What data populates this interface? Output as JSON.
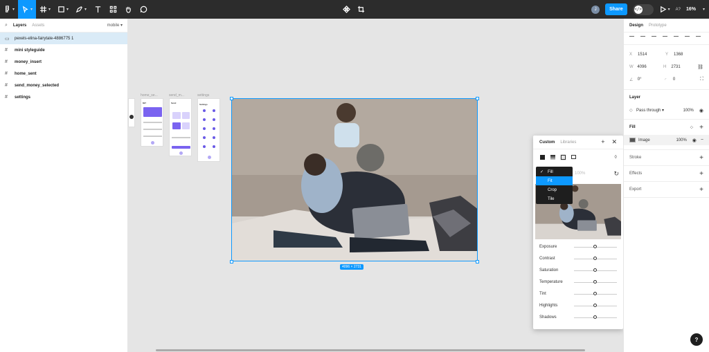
{
  "toolbar": {
    "zoom": "16%",
    "share": "Share",
    "user_initial": "J",
    "present_label": "A?"
  },
  "left": {
    "tabs": [
      "Layers",
      "Assets"
    ],
    "page": "mobile",
    "layers": [
      {
        "name": "pexels-elina-fairytale-4886775 1",
        "selected": true,
        "icon": "image-icon"
      },
      {
        "name": "mini styleguide",
        "icon": "frame-icon"
      },
      {
        "name": "money_insert",
        "icon": "frame-icon"
      },
      {
        "name": "home_sent",
        "icon": "frame-icon"
      },
      {
        "name": "send_money_selected",
        "icon": "frame-icon"
      },
      {
        "name": "settings",
        "icon": "frame-icon"
      }
    ]
  },
  "canvas": {
    "frame_labels": [
      "home_se...",
      "send_m...",
      "settings"
    ],
    "mini_titles": [
      "$97",
      "Send",
      "Settings"
    ],
    "dimensions": "4096 × 2731"
  },
  "popover": {
    "tabs": [
      "Custom",
      "Libraries"
    ],
    "modes": [
      "Fill",
      "Fit",
      "Crop",
      "Tile"
    ],
    "selected_mode": "Fill",
    "highlight_mode": "Fit",
    "opacity": "100%",
    "adjustments": [
      "Exposure",
      "Contrast",
      "Saturation",
      "Temperature",
      "Tint",
      "Highlights",
      "Shadows"
    ]
  },
  "right": {
    "tabs": [
      "Design",
      "Prototype"
    ],
    "x": "1514",
    "y": "1368",
    "w": "4096",
    "h": "2731",
    "rotation": "0°",
    "radius": "0",
    "layer_title": "Layer",
    "blend": "Pass through",
    "layer_opacity": "100%",
    "fill_title": "Fill",
    "fill_type": "Image",
    "fill_opacity": "100%",
    "stroke": "Stroke",
    "effects": "Effects",
    "export": "Export"
  },
  "colors": {
    "accent": "#0d99ff",
    "toolbar": "#2c2c2c"
  }
}
